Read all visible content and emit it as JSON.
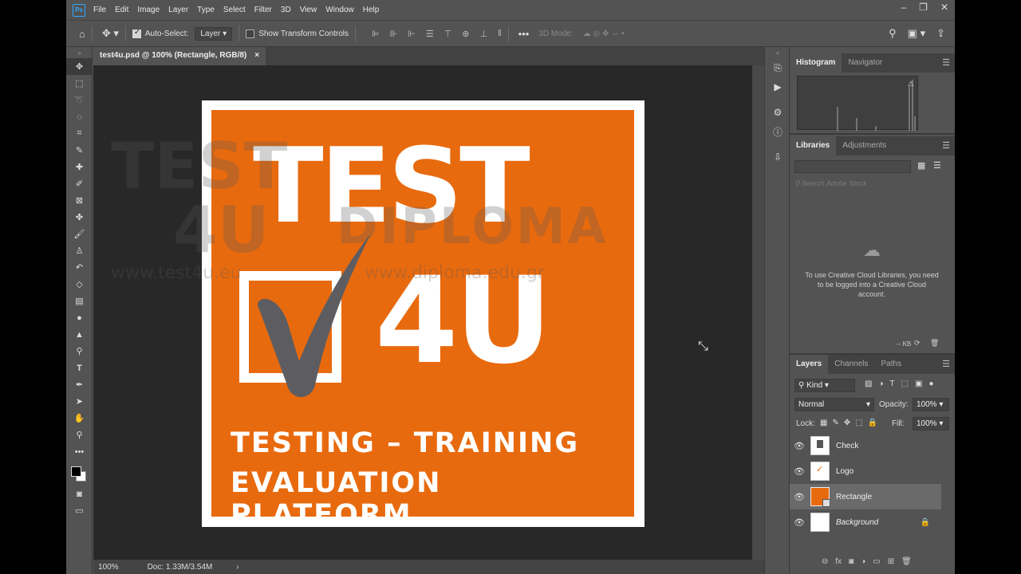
{
  "menu": {
    "app_icon": "Ps",
    "items": [
      "File",
      "Edit",
      "Image",
      "Layer",
      "Type",
      "Select",
      "Filter",
      "3D",
      "View",
      "Window",
      "Help"
    ]
  },
  "options_bar": {
    "auto_select_label": "Auto-Select:",
    "auto_select_value": "Layer",
    "show_transform_label": "Show Transform Controls",
    "mode_3d_label": "3D Mode:"
  },
  "document": {
    "tab_title": "test4u.psd @ 100% (Rectangle, RGB/8)",
    "tab_close": "×",
    "zoom": "100%",
    "doc_info": "Doc: 1.33M/3.54M",
    "status_arrow": "›"
  },
  "artwork": {
    "line1": "TEST",
    "line2": "4U",
    "tagline1": "TESTING  –  TRAINING",
    "tagline2": "EVALUATION PLATFORM",
    "brand_color": "#e86a0e"
  },
  "watermark": {
    "line1": "TEST",
    "line2": "4U",
    "brand": "DIPLOMA",
    "url1": "www.test4u.eu",
    "url2": "www.diploma.edu.gr"
  },
  "panels": {
    "histogram_tabs": [
      "Histogram",
      "Navigator"
    ],
    "libraries_tabs": [
      "Libraries",
      "Adjustments"
    ],
    "libraries_search_placeholder": "Search Adobe Stock",
    "libraries_message": "To use Creative Cloud Libraries, you need to be logged into a Creative Cloud account.",
    "libraries_size": "-- KB",
    "layers_tabs": [
      "Layers",
      "Channels",
      "Paths"
    ],
    "filter_kind": "Kind",
    "blend_mode": "Normal",
    "opacity_label": "Opacity:",
    "opacity_value": "100%",
    "lock_label": "Lock:",
    "fill_label": "Fill:",
    "fill_value": "100%",
    "layers": [
      {
        "name": "Check",
        "selected": false,
        "locked": false
      },
      {
        "name": "Logo",
        "selected": false,
        "locked": false
      },
      {
        "name": "Rectangle",
        "selected": true,
        "locked": false
      },
      {
        "name": "Background",
        "selected": false,
        "locked": true
      }
    ]
  }
}
